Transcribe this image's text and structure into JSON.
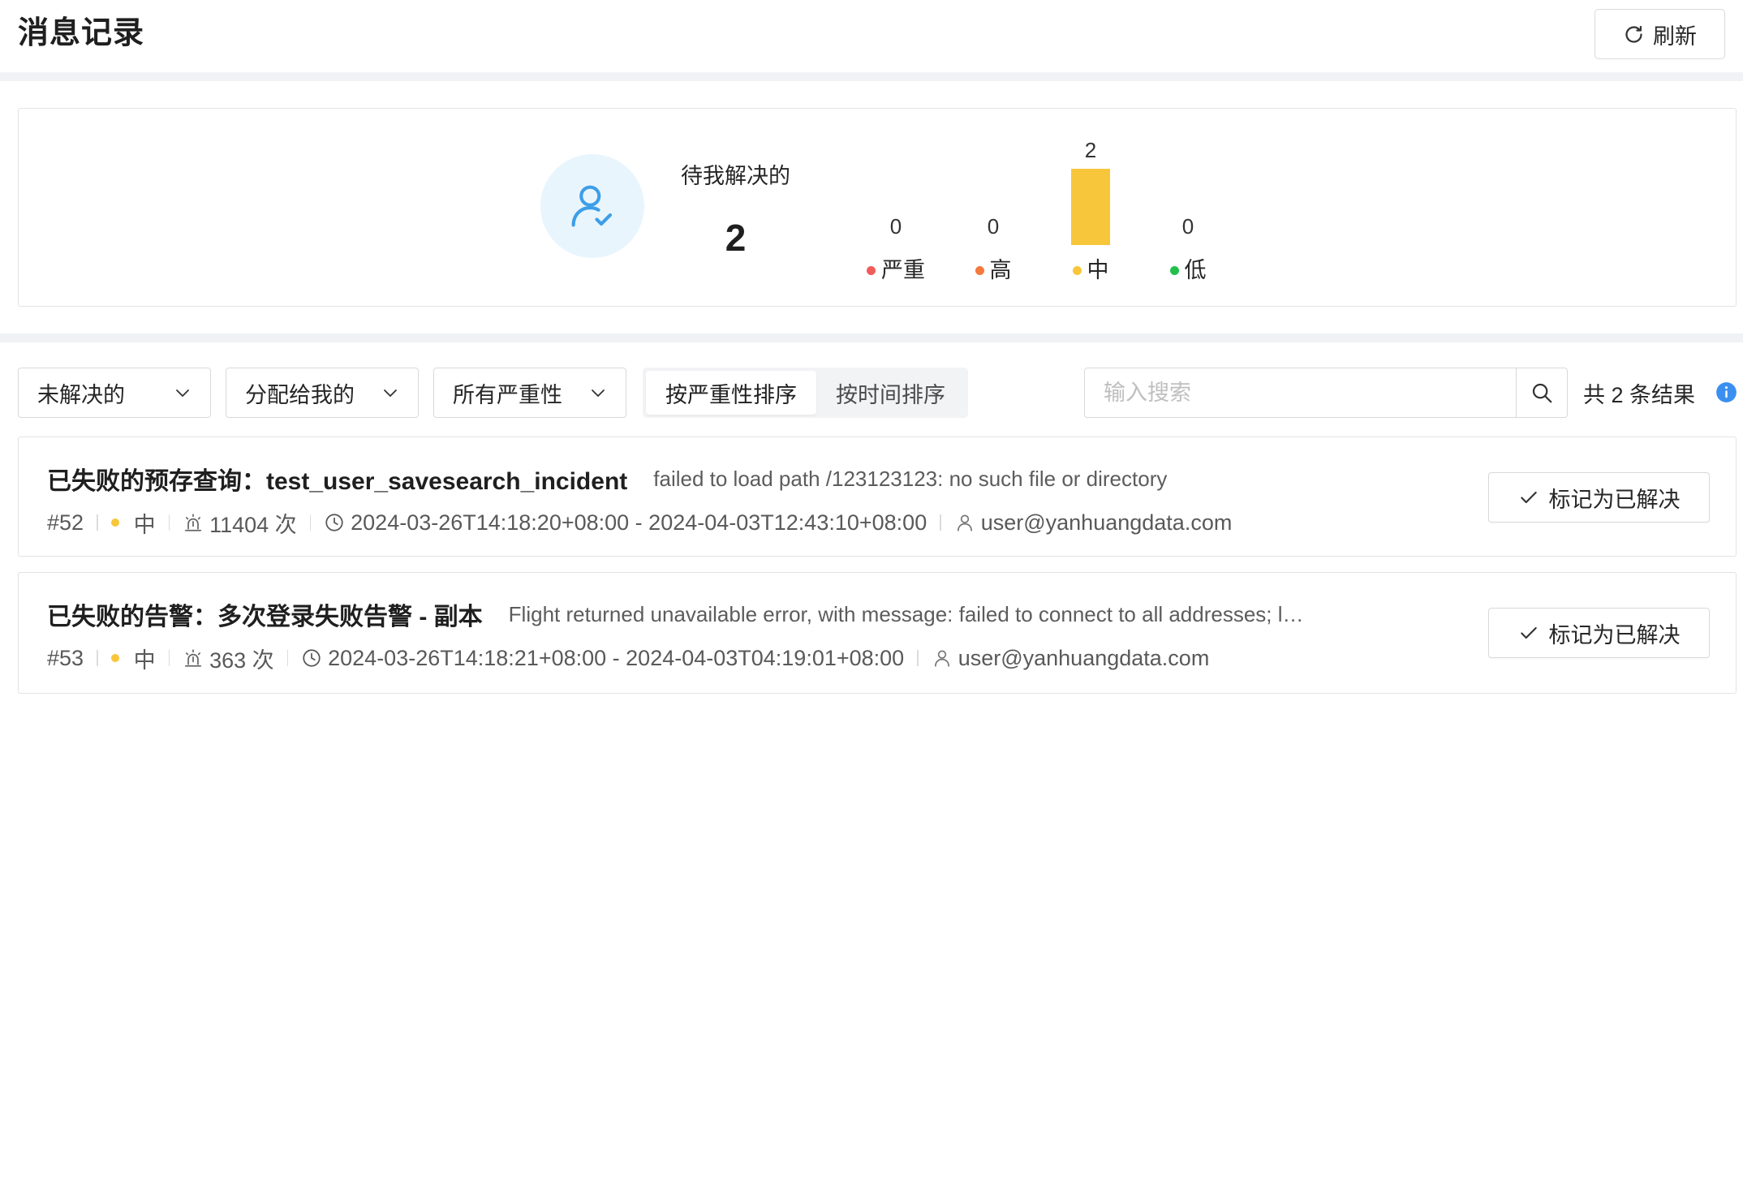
{
  "header": {
    "title": "消息记录",
    "refresh_label": "刷新",
    "refresh_icon": "refresh-icon"
  },
  "summary": {
    "label": "待我解决的",
    "count": "2",
    "icon": "user-check-icon",
    "icon_color": "#3d9ee8",
    "icon_bg": "#e9f5fd"
  },
  "chart_data": {
    "type": "bar",
    "categories": [
      "严重",
      "高",
      "中",
      "低"
    ],
    "values": [
      0,
      0,
      2,
      0
    ],
    "colors": [
      "#f25b5b",
      "#f5793b",
      "#f8c63b",
      "#22c04b"
    ]
  },
  "filters": {
    "status": "未解决的",
    "assignee": "分配给我的",
    "severity": "所有严重性",
    "sort_options": [
      {
        "label": "按严重性排序",
        "selected": true
      },
      {
        "label": "按时间排序",
        "selected": false
      }
    ],
    "search_placeholder": "输入搜索",
    "search_value": "",
    "result_text": "共 2 条结果",
    "info_color": "#3b8ff0"
  },
  "items": [
    {
      "title": "已失败的预存查询：test_user_savesearch_incident",
      "message": "failed to load path /123123123: no such file or directory",
      "id": "#52",
      "severity": "中",
      "severity_color": "#f8c63b",
      "trigger_count": "11404 次",
      "time_range": "2024-03-26T14:18:20+08:00 - 2024-04-03T12:43:10+08:00",
      "user": "user@yanhuangdata.com",
      "action_label": "标记为已解决"
    },
    {
      "title": "已失败的告警：多次登录失败告警 - 副本",
      "message": "Flight returned unavailable error, with message: failed to connect to all addresses; l…",
      "id": "#53",
      "severity": "中",
      "severity_color": "#f8c63b",
      "trigger_count": "363 次",
      "time_range": "2024-03-26T14:18:21+08:00 - 2024-04-03T04:19:01+08:00",
      "user": "user@yanhuangdata.com",
      "action_label": "标记为已解决"
    }
  ]
}
